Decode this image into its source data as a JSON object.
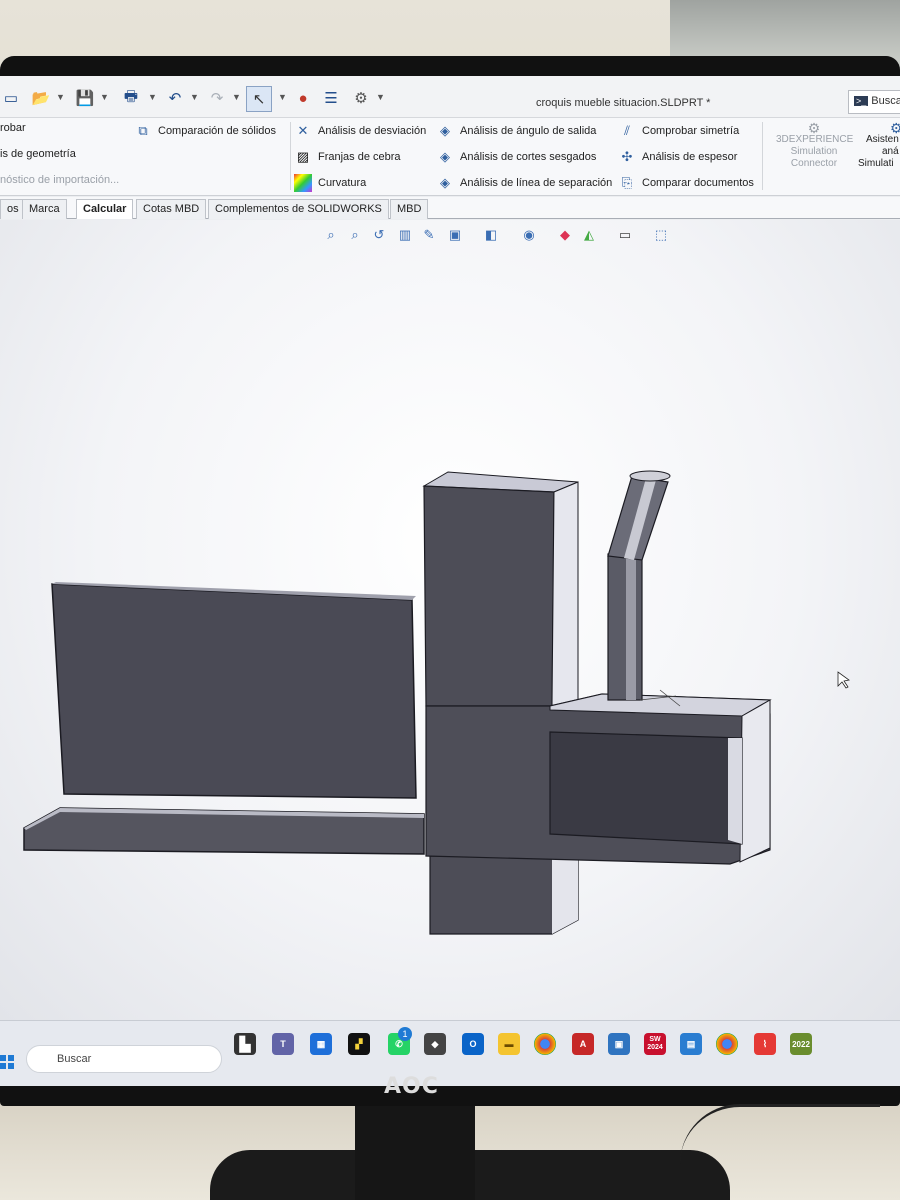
{
  "titlebar": {
    "document_title": "croquis mueble situacion.SLDPRT *",
    "search_label": "Buscar"
  },
  "ribbon": {
    "left_col": [
      "robar",
      "is de geometría",
      "nóstico de importación..."
    ],
    "comparacion": "Comparación de sólidos",
    "col2": [
      "Análisis de desviación",
      "Franjas de cebra",
      "Curvatura"
    ],
    "col3": [
      "Análisis de ángulo de salida",
      "Análisis de cortes sesgados",
      "Análisis de línea de separación"
    ],
    "col4": [
      "Comprobar simetría",
      "Análisis de espesor",
      "Comparar documentos"
    ],
    "sim_connector": [
      "3DEXPERIENCE",
      "Simulation",
      "Connector"
    ],
    "asistente": [
      "Asisten",
      "aná",
      "Simulati"
    ]
  },
  "tabs": [
    {
      "label": "os"
    },
    {
      "label": "Marca"
    },
    {
      "label": "Calcular",
      "active": true
    },
    {
      "label": "Cotas MBD"
    },
    {
      "label": "Complementos de SOLIDWORKS"
    },
    {
      "label": "MBD"
    }
  ],
  "taskbar": {
    "search_placeholder": "Buscar",
    "badge_count": "1",
    "sw_year": "2024",
    "extra_year": "2022"
  },
  "monitor": {
    "brand": "AOC"
  },
  "colors": {
    "model_front": "#4d4d57",
    "model_top": "#c9cad6",
    "model_side": "#e6e7ee",
    "accent": "#1f7ad4"
  }
}
